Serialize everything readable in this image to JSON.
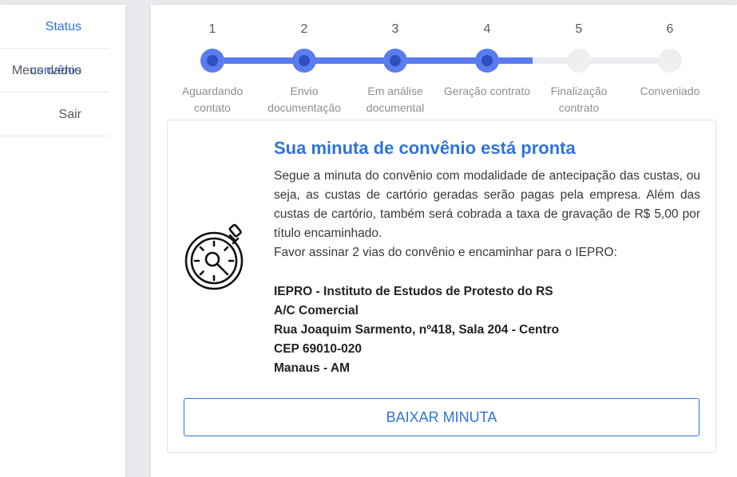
{
  "sidebar": {
    "items": [
      {
        "label": "Status convênio",
        "active": true
      },
      {
        "label": "Meus dados",
        "active": false
      },
      {
        "label": "Sair",
        "active": false
      }
    ]
  },
  "stepper": {
    "current_step": 4,
    "progress_percent": 70,
    "steps": [
      {
        "number": "1",
        "label_line1": "Aguardando",
        "label_line2": "contato",
        "done": true
      },
      {
        "number": "2",
        "label_line1": "Envio",
        "label_line2": "documentação",
        "done": true
      },
      {
        "number": "3",
        "label_line1": "Em análise",
        "label_line2": "documental",
        "done": true
      },
      {
        "number": "4",
        "label_line1": "Geração contrato",
        "label_line2": "",
        "done": true
      },
      {
        "number": "5",
        "label_line1": "Finalização",
        "label_line2": "contrato",
        "done": false
      },
      {
        "number": "6",
        "label_line1": "Conveniado",
        "label_line2": "",
        "done": false
      }
    ]
  },
  "card": {
    "title": "Sua minuta de convênio está pronta",
    "paragraph": "Segue a minuta do convênio com modalidade de antecipação das custas, ou seja, as custas de cartório geradas serão pagas pela empresa. Além das custas de cartório, também será cobrada a taxa de gravação de R$ 5,00 por título encaminhado.",
    "instruction": "Favor assinar 2 vias do convênio e encaminhar para o IEPRO:",
    "address": {
      "line1": "IEPRO - Instituto de Estudos de Protesto do RS",
      "line2": "A/C Comercial",
      "line3": "Rua Joaquim Sarmento, nº418, Sala 204 - Centro",
      "line4": "CEP 69010-020",
      "line5": "Manaus - AM"
    },
    "download_label": "BAIXAR MINUTA",
    "icon": "stopwatch-search-icon"
  },
  "colors": {
    "accent": "#2f73d8",
    "step_done": "#5a7cf0",
    "step_done_inner": "#2f4fbf",
    "step_todo": "#eeeff1"
  }
}
